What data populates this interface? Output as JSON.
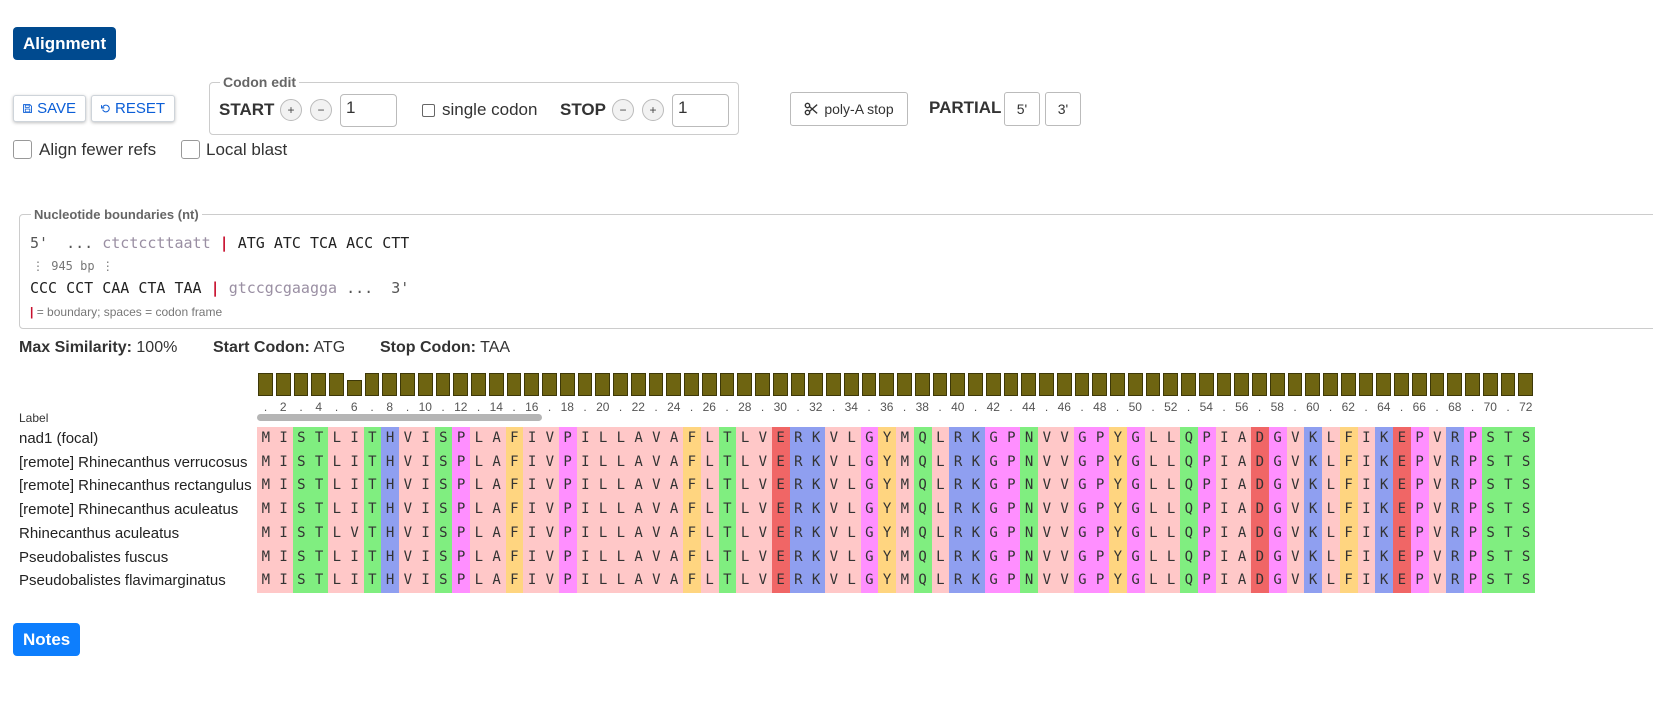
{
  "tabs": {
    "alignment": "Alignment",
    "notes": "Notes"
  },
  "toolbar": {
    "save": "SAVE",
    "reset": "RESET"
  },
  "codon_edit": {
    "legend": "Codon edit",
    "start_label": "START",
    "start_value": "1",
    "single_codon": "single codon",
    "stop_label": "STOP",
    "stop_value": "1",
    "plus": "+",
    "minus": "−"
  },
  "polyA": "poly-A stop",
  "partial": {
    "label": "PARTIAL",
    "five": "5'",
    "three": "3'"
  },
  "options": {
    "align_fewer": "Align fewer refs",
    "local_blast": "Local blast"
  },
  "nt": {
    "legend": "Nucleotide boundaries (nt)",
    "line1_prefix": "5'  ... ",
    "line1_flank": "ctctccttaatt",
    "bar": "|",
    "line1_codons": "ATG ATC TCA ACC CTT",
    "gap": "⋮ 945 bp ⋮",
    "line2_codons": "CCC CCT CAA CTA TAA",
    "line2_flank": "gtccgcgaagga",
    "line2_suffix": " ...  3'",
    "legend_note": "= boundary; spaces = codon frame"
  },
  "stats": {
    "max_sim_label": "Max Similarity:",
    "max_sim": "100%",
    "start_label": "Start Codon:",
    "start": "ATG",
    "stop_label": "Stop Codon:",
    "stop": "TAA"
  },
  "alignment": {
    "label_header": "Label",
    "sequence": "MISTLITHVISPLAFIVPILLAVAFLTLVERKVLGYMQLRKGPNVVGPYGLLQPIADGVKLFIKEPVRPSTS",
    "row4_sequence": "MISTLVTHVISPLAFIVPILLAVAFLTLVERKVLGYMQLRKGPNVVGPYGLLQPIADGVKLFIKEPVRPSTS",
    "rows": [
      "nad1 (focal)",
      "[remote] Rhinecanthus verrucosus",
      "[remote] Rhinecanthus rectangulus",
      "[remote] Rhinecanthus aculeatus",
      "Rhinecanthus  aculeatus",
      "Pseudobalistes  fuscus",
      "Pseudobalistes  flavimarginatus"
    ],
    "tick_labels": [
      "2",
      "4",
      "6",
      "8",
      "10",
      "12",
      "14",
      "16",
      "18",
      "20",
      "22",
      "24",
      "26",
      "28",
      "30",
      "32",
      "34",
      "36",
      "38",
      "40",
      "42",
      "44",
      "46",
      "48",
      "50",
      "52",
      "54",
      "56",
      "58",
      "60",
      "62",
      "64",
      "66",
      "68",
      "70",
      "72"
    ],
    "conservation": [
      1,
      1,
      1,
      1,
      1,
      0.7,
      1,
      1,
      1,
      1,
      1,
      1,
      1,
      1,
      1,
      1,
      1,
      1,
      1,
      1,
      1,
      1,
      1,
      1,
      1,
      1,
      1,
      1,
      1,
      1,
      1,
      1,
      1,
      1,
      1,
      1,
      1,
      1,
      1,
      1,
      1,
      1,
      1,
      1,
      1,
      1,
      1,
      1,
      1,
      1,
      1,
      1,
      1,
      1,
      1,
      1,
      1,
      1,
      1,
      1,
      1,
      1,
      1,
      1,
      1,
      1,
      1,
      1,
      1,
      1,
      1,
      1
    ],
    "colors": {
      "A": "#ffc8c8",
      "C": "#ffc8c8",
      "D": "#f06666",
      "E": "#f06666",
      "F": "#ffd580",
      "G": "#ff8fff",
      "H": "#8f9ff0",
      "I": "#ffc8c8",
      "K": "#8f9ff0",
      "L": "#ffc8c8",
      "M": "#ffc8c8",
      "N": "#80ee80",
      "P": "#ff8fff",
      "Q": "#80ee80",
      "R": "#8f9ff0",
      "S": "#80ee80",
      "T": "#80ee80",
      "V": "#ffc8c8",
      "W": "#ffd580",
      "Y": "#ffd580"
    },
    "bar_color": "#6e6411"
  }
}
